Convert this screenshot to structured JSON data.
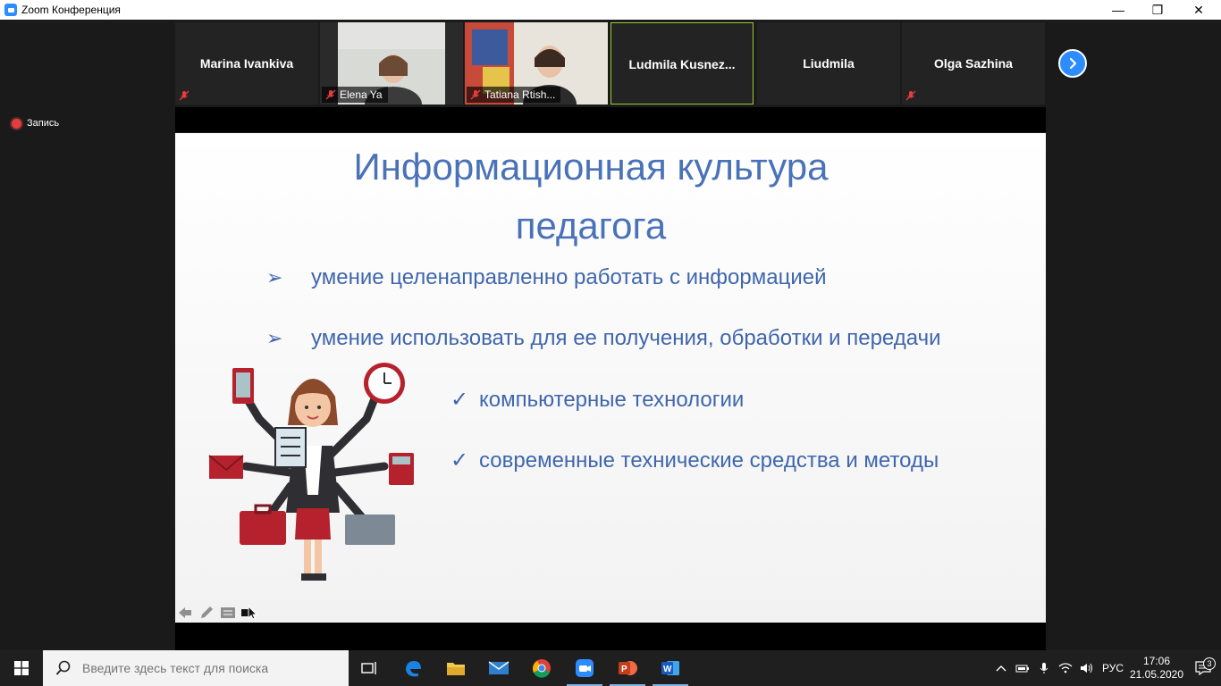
{
  "window": {
    "title": "Zoom Конференция",
    "minimize_glyph": "—",
    "maximize_glyph": "❐",
    "close_glyph": "✕"
  },
  "recording": {
    "label": "Запись"
  },
  "participants": [
    {
      "name": "Marina Ivankiva",
      "video": false,
      "muted": true
    },
    {
      "name": "Elena Ya",
      "video": true,
      "muted": true
    },
    {
      "name": "Tatiana Rtish...",
      "video": true,
      "muted": true
    },
    {
      "name": "Ludmila  Kusnez...",
      "video": false,
      "muted": false,
      "active_speaker": true
    },
    {
      "name": "Liudmila",
      "video": false,
      "muted": false
    },
    {
      "name": "Olga Sazhina",
      "video": false,
      "muted": true
    }
  ],
  "slide": {
    "title_line1": "Информационная культура",
    "title_line2": "педагога",
    "bullet1": "умение целенаправленно работать с информацией",
    "bullet2": "умение использовать для ее получения, обработки и передачи",
    "sub1": "компьютерные технологии",
    "sub2": "современные технические средства и методы",
    "arrow_glyph": "➢",
    "check_glyph": "✓"
  },
  "taskbar": {
    "search_placeholder": "Введите здесь текст для поиска",
    "language": "РУС",
    "time": "17:06",
    "date": "21.05.2020",
    "notifications": "3"
  },
  "colors": {
    "accent": "#2d8cff",
    "slide_text": "#4a72b8",
    "active_border": "#9acd32"
  }
}
